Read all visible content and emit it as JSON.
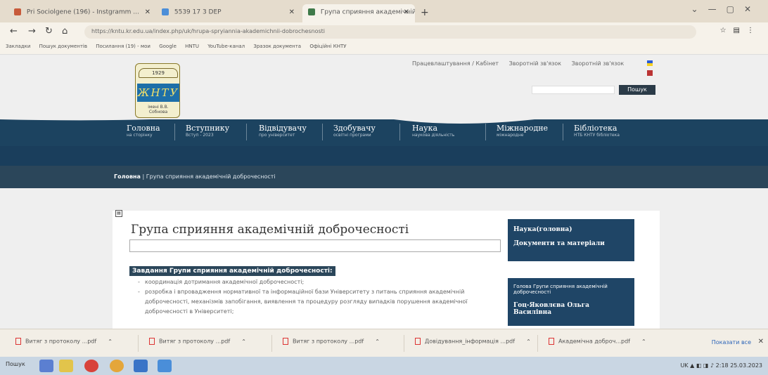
{
  "browser": {
    "tabs": [
      {
        "label": "Pri Sociolgene (196) - Instgramm ... ",
        "active": false
      },
      {
        "label": "5539 17 3 DEP",
        "active": false
      },
      {
        "label": "Група сприяння академічній добі...",
        "active": true
      }
    ],
    "address": "https://kntu.kr.edu.ua/index.php/uk/hrupa-spryiannia-akademichnii-dobrochesnosti",
    "bookmarks": [
      "Закладки",
      "Пошук документів",
      "Посилання (19) - мои",
      "Google",
      "HNTU",
      "YouTube-канал",
      "Зразок документа",
      "Офіційні КНТУ"
    ]
  },
  "site": {
    "toplinks": [
      "Працевлаштування / Кабінет",
      "Зворотній зв'язок",
      "Зворотній зв'язок"
    ],
    "search_button": "Пошук",
    "logo": {
      "ribbon": "1929",
      "mark": "ЖНТУ",
      "name": "імені В.В. Собнова"
    },
    "menu": [
      {
        "title": "Головна",
        "sub": "на сторінку"
      },
      {
        "title": "Вступнику",
        "sub": "Вступ - 2023"
      },
      {
        "title": "Відвідувачу",
        "sub": "про університет"
      },
      {
        "title": "Здобувачу",
        "sub": "освітні програми"
      },
      {
        "title": "Наука",
        "sub": "наукова діяльність"
      },
      {
        "title": "Міжнародне",
        "sub": "міжнародне"
      },
      {
        "title": "Бібліотека",
        "sub": "НТБ КНТУ бібліотека"
      }
    ],
    "breadcrumb": {
      "home": "Головна",
      "current": "Група сприяння академічній доброчесності"
    }
  },
  "content": {
    "title": "Група сприяння академічній доброчесності",
    "tasks_heading": "Завдання Групи сприяння академічній доброчесності:",
    "bullets": [
      "координація дотримання академічної доброчесності;",
      "розробка і впровадження нормативної та інформаційної бази Університету з питань сприяння академічній доброчесності, механізмів запобігання, виявлення та процедуру розгляду випадків порушення академічної доброчесності в Університеті;"
    ]
  },
  "sidebar": {
    "items": [
      "Наука(головна)",
      "Документи та матеріали"
    ],
    "group_head_label": "Голова Групи сприяння академічній доброчесності",
    "group_head_name": "Гоц-Яковлєва Ольга Василівна"
  },
  "downloads": {
    "items": [
      "Витяг з протоколу ...pdf",
      "Витяг з протоколу ...pdf",
      "Витяг з протоколу ...pdf",
      "Довідування_інформація ...pdf",
      "Академічна доброч...pdf"
    ],
    "show_all": "Показати все"
  },
  "taskbar": {
    "start": "Пошук",
    "lang": "UK",
    "time": "2:18",
    "date": "25.03.2023"
  },
  "colors": {
    "navy": "#1f4566",
    "band": "#2b465a",
    "tabbar": "#e5dccd"
  }
}
